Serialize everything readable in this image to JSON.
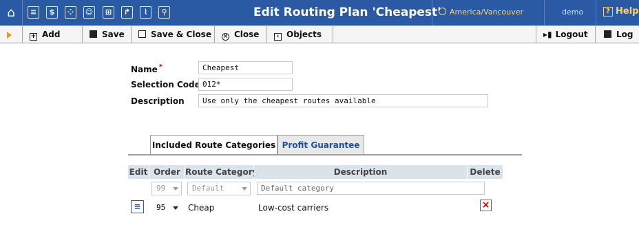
{
  "header": {
    "title": "Edit Routing Plan 'Cheapest'",
    "timezone": "America/Vancouver",
    "user": "demo",
    "help": "Help",
    "nav_icons": [
      "home-icon",
      "list-icon",
      "dollar-icon",
      "grid-icon",
      "person-icon",
      "bracket-icon",
      "route-icon",
      "chart-icon",
      "search-icon"
    ]
  },
  "toolbar": {
    "add": "Add",
    "save": "Save",
    "save_close": "Save & Close",
    "close": "Close",
    "objects": "Objects",
    "logout": "Logout",
    "log": "Log"
  },
  "form": {
    "name_label": "Name",
    "name_value": "Cheapest",
    "selection_code_label": "Selection Code",
    "selection_code_value": "012*",
    "description_label": "Description",
    "description_value": "Use only the cheapest routes available"
  },
  "tabs": [
    {
      "label": "Included Route Categories"
    },
    {
      "label": "Profit Guarantee"
    }
  ],
  "table": {
    "columns": [
      "Edit",
      "Order",
      "Route Category",
      "Description",
      "Delete"
    ],
    "default_row": {
      "order": "99",
      "category": "Default",
      "description": "Default category"
    },
    "rows": [
      {
        "order": "95",
        "category": "Cheap",
        "description": "Low-cost carriers"
      }
    ]
  },
  "colors": {
    "header_bg": "#2a5aa3",
    "accent": "#ffd36a",
    "tab_link": "#1f4f9c",
    "delete": "#d00000"
  }
}
